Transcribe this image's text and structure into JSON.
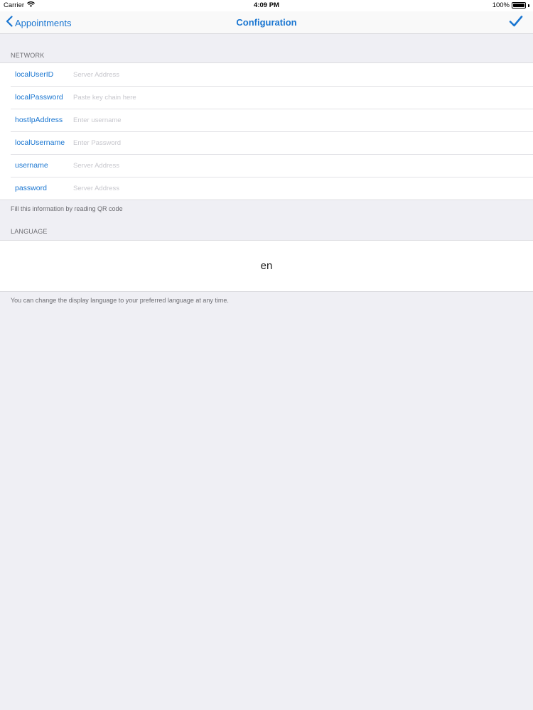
{
  "status_bar": {
    "carrier": "Carrier",
    "time": "4:09 PM",
    "battery": "100%",
    "battery_level": 1.0
  },
  "nav": {
    "back_label": "Appointments",
    "title": "Configuration",
    "done_icon": "checkmark-icon"
  },
  "network": {
    "header": "NETWORK",
    "rows": [
      {
        "label": "localUserID",
        "placeholder": "Server Address"
      },
      {
        "label": "localPassword",
        "placeholder": "Paste key chain here"
      },
      {
        "label": "hostIpAddress",
        "placeholder": "Enter username"
      },
      {
        "label": "localUsername",
        "placeholder": "Enter Password"
      },
      {
        "label": "username",
        "placeholder": "Server Address"
      },
      {
        "label": "password",
        "placeholder": "Server Address"
      }
    ],
    "footer": "Fill this information by reading QR code"
  },
  "language": {
    "header": "LANGUAGE",
    "value": "en",
    "footer": "You can change the display language to your preferred language at any time."
  },
  "colors": {
    "accent": "#1a76d1",
    "background": "#efeff4",
    "cell": "#ffffff",
    "secondary_text": "#6d6d72",
    "placeholder": "#c7c7cd"
  }
}
